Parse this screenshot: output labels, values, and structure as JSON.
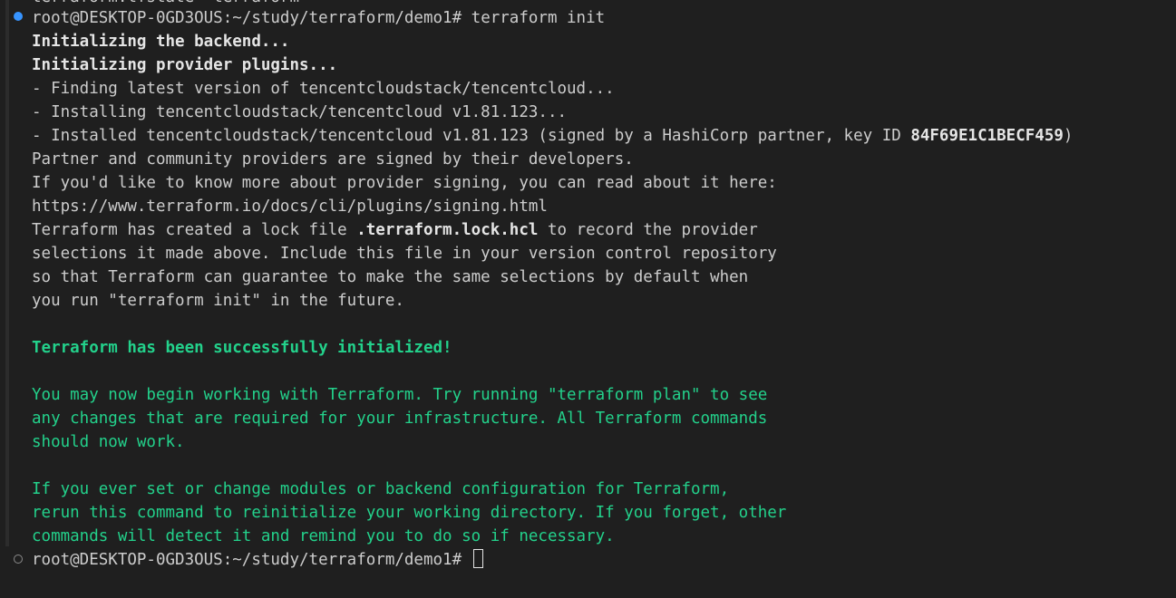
{
  "terminal": {
    "cut_text": "terraform.tfstate  terraform",
    "prompt": "root@DESKTOP-0GD3OUS:~/study/terraform/demo1#",
    "command": " terraform init",
    "prompt_current": "root@DESKTOP-0GD3OUS:~/study/terraform/demo1#",
    "lines": {
      "l1": "Initializing the backend...",
      "l2": "Initializing provider plugins...",
      "l3": "- Finding latest version of tencentcloudstack/tencentcloud...",
      "l4": "- Installing tencentcloudstack/tencentcloud v1.81.123...",
      "l5a": "- Installed tencentcloudstack/tencentcloud v1.81.123 (signed by a HashiCorp partner, key ID ",
      "l5b": "84F69E1C1BECF459",
      "l5c": ")",
      "l6": "Partner and community providers are signed by their developers.",
      "l7": "If you'd like to know more about provider signing, you can read about it here:",
      "l8": "https://www.terraform.io/docs/cli/plugins/signing.html",
      "l9a": "Terraform has created a lock file ",
      "l9b": ".terraform.lock.hcl",
      "l9c": " to record the provider",
      "l10": "selections it made above. Include this file in your version control repository",
      "l11": "so that Terraform can guarantee to make the same selections by default when",
      "l12": "you run \"terraform init\" in the future.",
      "l13": "Terraform has been successfully initialized!",
      "l14": "You may now begin working with Terraform. Try running \"terraform plan\" to see",
      "l15": "any changes that are required for your infrastructure. All Terraform commands",
      "l16": "should now work.",
      "l17": "If you ever set or change modules or backend configuration for Terraform,",
      "l18": "rerun this command to reinitialize your working directory. If you forget, other",
      "l19": "commands will detect it and remind you to do so if necessary."
    }
  },
  "colors": {
    "background": "#1f1f1f",
    "text": "#cccccc",
    "success": "#23d18b",
    "command_mark_done": "#3794ff"
  }
}
